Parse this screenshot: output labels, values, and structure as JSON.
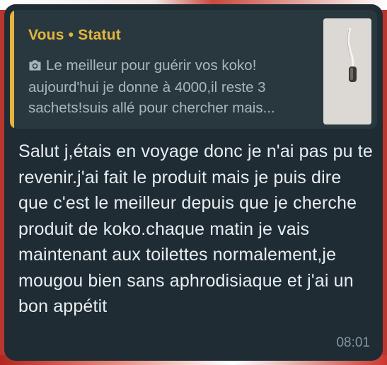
{
  "reply_quote": {
    "sender": "Vous",
    "separator": "•",
    "type_label": "Statut",
    "camera_icon": "camera-icon",
    "text": "Le meilleur pour guérir vos koko! aujourd'hui je donne à 4000,il reste 3 sachets!suis allé pour chercher mais...",
    "accent_color": "#e3b53d"
  },
  "message": {
    "text": "Salut j,étais en voyage donc je n'ai pas pu te revenir.j'ai fait le produit mais je puis dire que c'est le meilleur depuis que je cherche produit de koko.chaque matin je vais maintenant aux toilettes normalement,je mougou bien sans aphrodisiaque et j'ai un bon appétit",
    "time": "08:01"
  },
  "colors": {
    "bubble": "#1f2c34",
    "quote_bg": "#29383f",
    "message_text": "#e9edef",
    "time_text": "#8696a0"
  }
}
